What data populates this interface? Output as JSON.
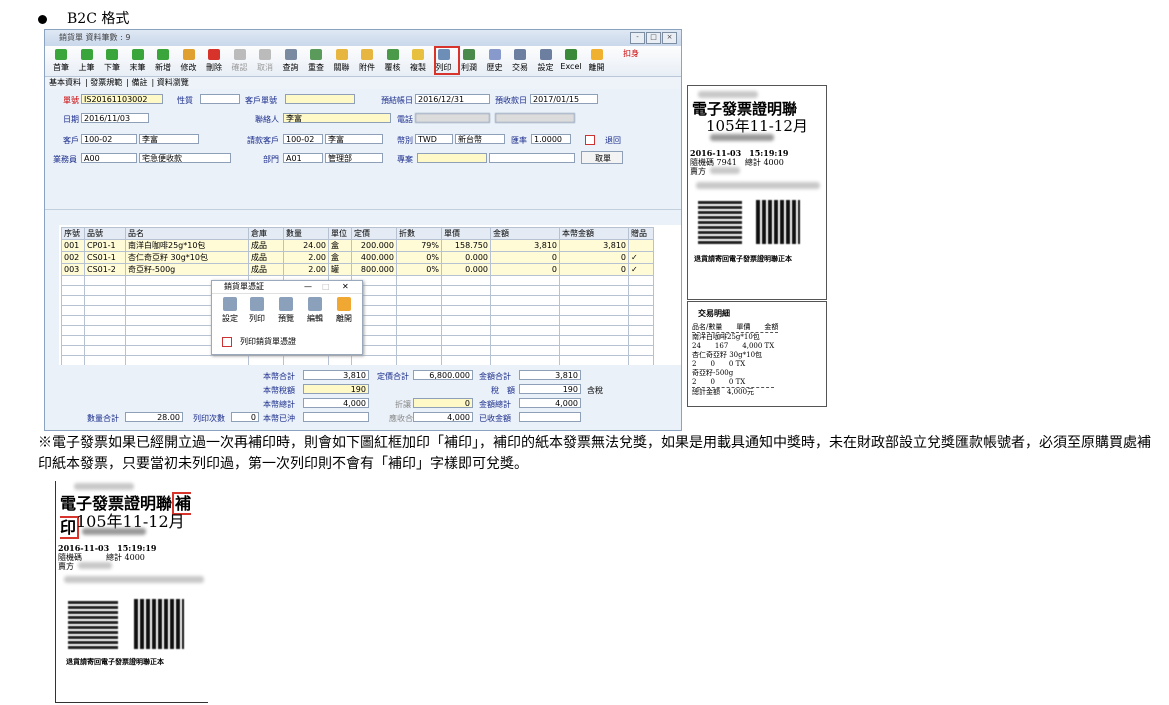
{
  "heading": "B2C 格式",
  "window": {
    "title": "銷貨單 資料筆數 : 9",
    "controls": [
      "-",
      "□",
      "×"
    ]
  },
  "toolbar": {
    "buttons": [
      "首筆",
      "上筆",
      "下筆",
      "末筆",
      "新增",
      "修改",
      "刪除",
      "確認",
      "取消",
      "查詢",
      "重查",
      "關聯",
      "附件",
      "覆核",
      "複製",
      "列印",
      "利潤",
      "歷史",
      "交易",
      "設定",
      "Excel",
      "離開"
    ],
    "disabled": [
      "確認",
      "取消"
    ],
    "highlighted": "列印",
    "assist_label": "扣身"
  },
  "tabs": [
    "基本資料",
    "發票規範",
    "備註",
    "資料瀏覽"
  ],
  "form": {
    "order_no_label": "單號",
    "order_no": "IS20161103002",
    "nature_label": "性質",
    "cust_order_label": "客戶單號",
    "est_date_label": "預結帳日",
    "est_date": "2016/12/31",
    "est_collect_label": "預收款日",
    "est_collect": "2017/01/15",
    "date_label": "日期",
    "date": "2016/11/03",
    "contact_label": "聯絡人",
    "contact": "李富",
    "phone_label": "電話",
    "customer_label": "客戶",
    "customer_code": "100-02",
    "customer_name": "李富",
    "bill_cust_label": "請款客戶",
    "bill_cust_code": "100-02",
    "bill_cust_name": "李富",
    "currency_label": "幣別",
    "currency": "TWD",
    "currency_name": "新台幣",
    "rate_label": "匯率",
    "rate": "1.0000",
    "return_label": "退回",
    "sales_label": "業務員",
    "sales_code": "A00",
    "sales_name": "宅急便收款",
    "dept_label": "部門",
    "dept_code": "A01",
    "dept_name": "管理部",
    "project_label": "專案",
    "fetch_button": "取單"
  },
  "grid": {
    "headers": [
      "序號",
      "品號",
      "品名",
      "倉庫",
      "數量",
      "單位",
      "定價",
      "折數",
      "單價",
      "金額",
      "本幣金額",
      "贈品"
    ],
    "rows": [
      [
        "001",
        "CP01-1",
        "南洋白咖啡25g*10包",
        "成品",
        "24.00",
        "盒",
        "200.000",
        "79%",
        "158.750",
        "3,810",
        "3,810",
        ""
      ],
      [
        "002",
        "CS01-1",
        "杏仁奇亞籽 30g*10包",
        "成品",
        "2.00",
        "盒",
        "400.000",
        "0%",
        "0.000",
        "0",
        "0",
        "✓"
      ],
      [
        "003",
        "CS01-2",
        "奇亞籽-500g",
        "成品",
        "2.00",
        "罐",
        "800.000",
        "0%",
        "0.000",
        "0",
        "0",
        "✓"
      ]
    ]
  },
  "popup": {
    "title": "銷貨單憑証",
    "controls": [
      "—",
      "□",
      "✕"
    ],
    "buttons": [
      "設定",
      "列印",
      "預覽",
      "編輯",
      "離開"
    ],
    "checkbox_label": "列印銷貨單憑證"
  },
  "totals": {
    "base_total_label": "本幣合計",
    "base_total": "3,810",
    "list_total_label": "定價合計",
    "list_total": "6,800.000",
    "amount_total_label": "金額合計",
    "amount_total": "3,810",
    "base_tax_label": "本幣稅額",
    "base_tax": "190",
    "tax_label": "稅　額",
    "tax": "190",
    "tax_incl_label": "含稅",
    "base_sum_label": "本幣總計",
    "base_sum": "4,000",
    "discount_label": "折讓",
    "discount": "0",
    "amount_sum_label": "金額總計",
    "amount_sum": "4,000",
    "qty_total_label": "數量合計",
    "qty_total": "28.00",
    "print_count_label": "列印次數",
    "print_count": "0",
    "base_offset_label": "本幣已沖",
    "recv_total_label": "應收合計",
    "recv_total": "4,000",
    "received_label": "已收金額"
  },
  "receipt1": {
    "title": "電子發票證明聯",
    "period": "105年11-12月",
    "datetime": "2016-11-03　15:19:19",
    "random_label": "隨機碼 7941",
    "total_label": "總計 4000",
    "seller_label": "賣方",
    "footer": "退貨請寄回電子發票證明聯正本"
  },
  "receipt2": {
    "title": "交易明細",
    "header": "品名/數量　　單價　　金額",
    "lines": [
      "南洋白咖啡25g*10包",
      "24　　167　　4,000 TX",
      "杏仁奇亞籽 30g*10包",
      "2　　0　　0 TX",
      "奇亞籽-500g",
      "2　　0　　0 TX",
      "總計金額　4,000元"
    ]
  },
  "note": "※電子發票如果已經開立過一次再補印時，則會如下圖紅框加印「補印」，補印的紙本發票無法兌獎，如果是用載具通知中獎時，未在財政部設立兌獎匯款帳號者，必須至原購買處補印紙本發票，只要當初未列印過，第一次列印則不會有「補印」字樣即可兌獎。",
  "receipt3": {
    "title": "電子發票證明聯",
    "reprint": "補印",
    "period": "105年11-12月",
    "datetime": "2016-11-03　15:19:19",
    "random_label": "隨機碼",
    "total_label": "總計 4000",
    "seller_label": "賣方",
    "footer": "退貨請寄回電子發票證明聯正本"
  },
  "colors": {
    "highlight_red": "#d9342b",
    "field_yellow": "#fff9c8",
    "window_bg": "#eaf1f9"
  }
}
